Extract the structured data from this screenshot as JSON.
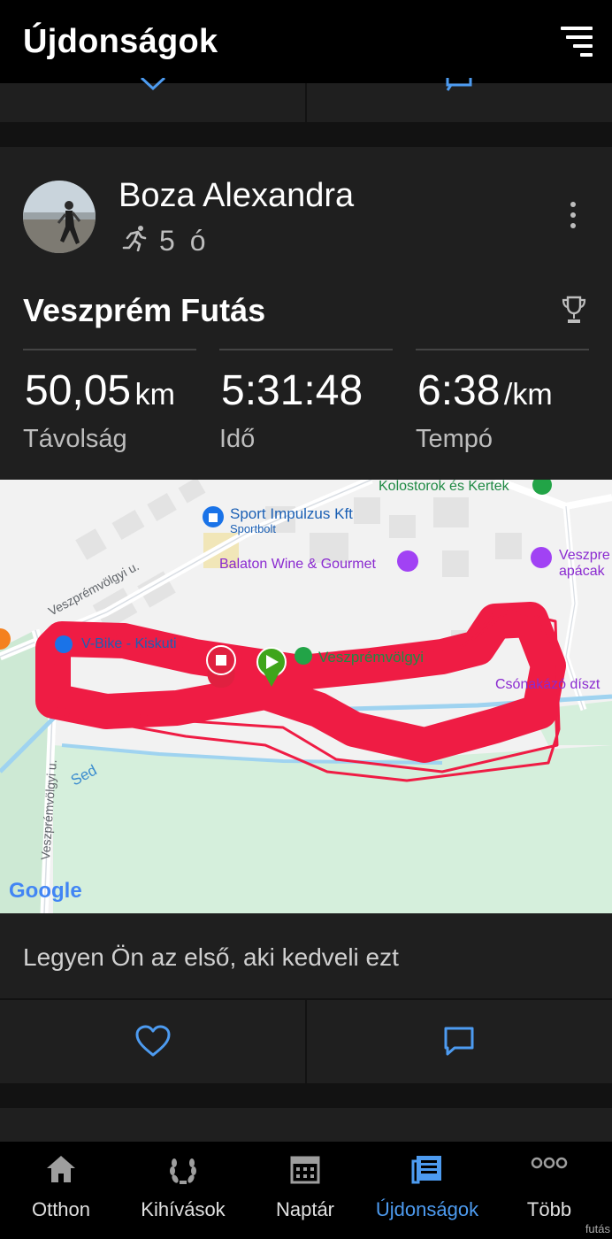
{
  "header": {
    "title": "Újdonságok"
  },
  "activity": {
    "user_name": "Boza Alexandra",
    "time_ago": "5 ó",
    "title": "Veszprém Futás",
    "stats": [
      {
        "value": "50,05",
        "unit": "km",
        "label": "Távolság"
      },
      {
        "value": "5:31:48",
        "unit": "",
        "label": "Idő"
      },
      {
        "value": "6:38",
        "unit": "/km",
        "label": "Tempó"
      }
    ],
    "likes_text": "Legyen Ön az első, aki kedveli ezt"
  },
  "map": {
    "labels": [
      "Kolostorok és Kertek",
      "Sport Impulzus Kft",
      "Sportbolt",
      "Balaton Wine & Gourmet",
      "Veszpre",
      "apácak",
      "Veszprémvölgyi u.",
      "V-Bike - Kiskuti",
      "Veszprémvölgyi",
      "Csónakázó díszt",
      "Sed",
      "Veszprémvölgyi u.",
      "Google"
    ],
    "route_color": "#ef1c44",
    "start_color": "#3fa51b",
    "finish_color": "#e02040"
  },
  "bottom_nav": [
    {
      "label": "Otthon",
      "icon": "home-icon",
      "active": false
    },
    {
      "label": "Kihívások",
      "icon": "laurel-icon",
      "active": false
    },
    {
      "label": "Naptár",
      "icon": "calendar-icon",
      "active": false
    },
    {
      "label": "Újdonságok",
      "icon": "newsfeed-icon",
      "active": true
    },
    {
      "label": "Több",
      "icon": "more-icon",
      "active": false
    }
  ],
  "watermark": "futás",
  "colors": {
    "accent": "#4d9bf0",
    "background": "#121212",
    "card": "#1f1f1f"
  }
}
